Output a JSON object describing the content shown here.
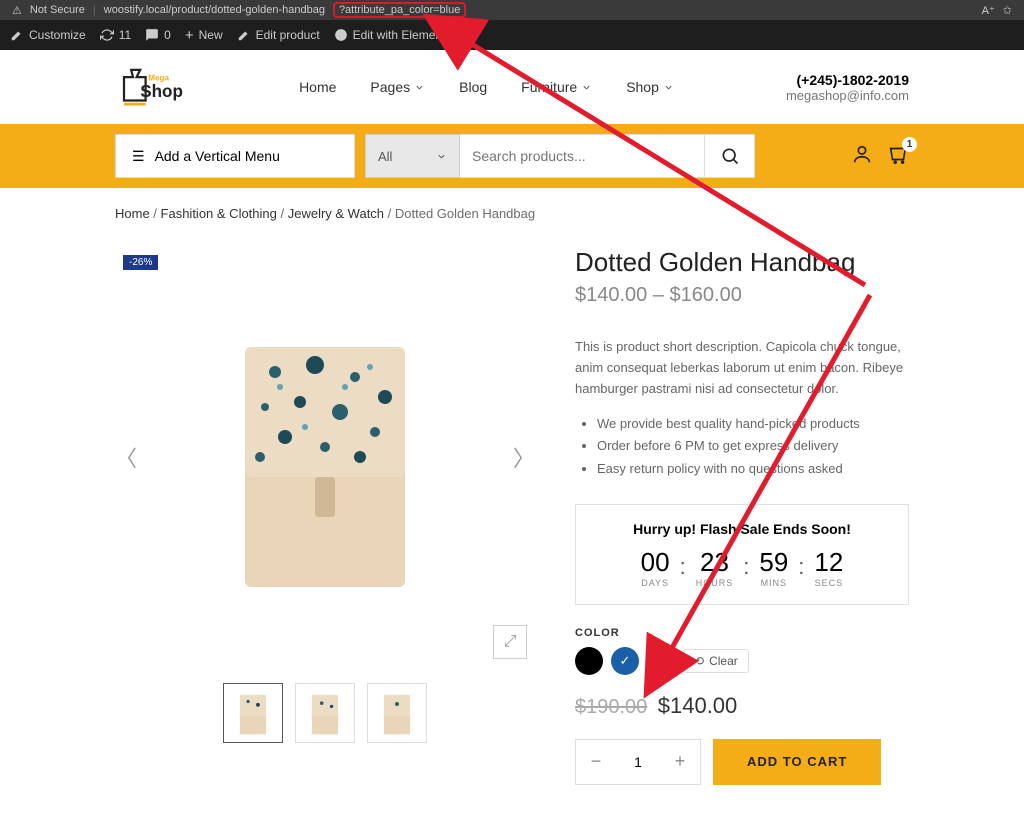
{
  "browser": {
    "not_secure": "Not Secure",
    "url_pre": "woostify.local/product/dotted-golden-handbag",
    "url_hl": "?attribute_pa_color=blue"
  },
  "wp": {
    "customize": "Customize",
    "updates": "11",
    "comments": "0",
    "new": "New",
    "edit": "Edit product",
    "elementor": "Edit with Elementor"
  },
  "logo": {
    "mega": "Mega",
    "shop": "Shop"
  },
  "nav": {
    "home": "Home",
    "pages": "Pages",
    "blog": "Blog",
    "furniture": "Furniture",
    "shop": "Shop"
  },
  "contact": {
    "phone": "(+245)-1802-2019",
    "email": "megashop@info.com"
  },
  "bar": {
    "vmenu": "Add a Vertical Menu",
    "cat": "All",
    "search_ph": "Search products...",
    "cart_badge": "1"
  },
  "breadcrumb": {
    "home": "Home",
    "c1": "Fashition & Clothing",
    "c2": "Jewelry & Watch",
    "cur": "Dotted Golden Handbag",
    "sep": " / "
  },
  "discount": "-26%",
  "product": {
    "title": "Dotted Golden Handbag",
    "range": "$140.00 – $160.00",
    "desc": "This is product short description. Capicola chuck tongue, anim consequat leberkas laborum ut enim bacon. Ribeye hamburger pastrami nisi ad consectetur dolor.",
    "feat1": "We provide best quality hand-picked products",
    "feat2": "Order before 6 PM to get express delivery",
    "feat3": "Easy return policy with no questions asked"
  },
  "flash": {
    "title": "Hurry up! Flash Sale Ends Soon!",
    "d": "00",
    "dl": "DAYS",
    "h": "23",
    "hl": "HOURS",
    "m": "59",
    "ml": "MINS",
    "s": "12",
    "sl": "SECS"
  },
  "color": {
    "label": "COLOR",
    "clear": "Clear"
  },
  "price": {
    "old": "$190.00",
    "new": "$140.00"
  },
  "cart": {
    "qty": "1",
    "add": "ADD TO CART"
  }
}
